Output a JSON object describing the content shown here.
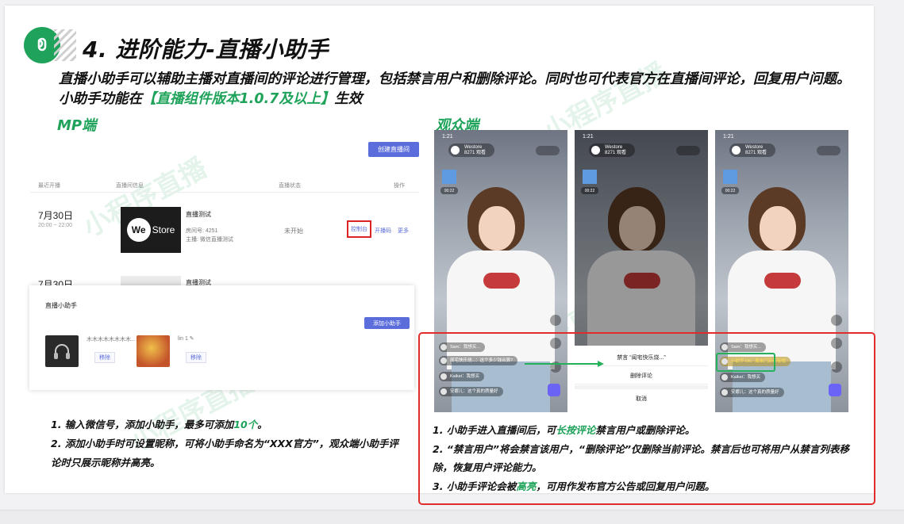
{
  "slide": {
    "title": "4. 进阶能力-直播小助手",
    "desc_part1": "直播小助手可以辅助主播对直播间的评论进行管理，包括禁言用户和删除评论。同时也可代表官方在直播间评论，回复用户问题。小助手功能在",
    "desc_highlight": "【直播组件版本1.0.7及以上】",
    "desc_part2": "生效",
    "mp_label": "MP端",
    "viewer_label": "观众端",
    "watermark": "小程序直播"
  },
  "mp": {
    "create_button": "创建直播间",
    "headers": [
      "最近开播",
      "直播间信息",
      "直播状态",
      "操作"
    ],
    "rows": [
      {
        "date": "7月30日",
        "time": "20:00 ~ 22:00",
        "thumb_text_a": "We",
        "thumb_text_b": "Store",
        "room_title": "直播测试",
        "room_no": "房间号:  4251",
        "host": "主播:    微信直播测试",
        "status": "未开始",
        "action_console": "控制台",
        "action_push": "开播码",
        "action_more": "更多"
      },
      {
        "date": "7月30日",
        "room_title": "直播测试"
      }
    ],
    "assistant": {
      "title": "直播小助手",
      "add_button": "添加小助手",
      "users": [
        {
          "name": "木木木木木木木木...",
          "remove": "移除"
        },
        {
          "name": "lin 1 ✎",
          "remove": "移除"
        }
      ]
    },
    "notes": {
      "line1_a": "1. 输入微信号，添加小助手，最多可添加",
      "line1_hl": "10个",
      "line1_b": "。",
      "line2": "2. 添加小助手时可设置昵称，可将小助手命名为“XXX官方”，观众端小助手评论时只展示昵称并高亮。"
    }
  },
  "viewer": {
    "phones": [
      {
        "time": "1:21",
        "anchor_name": "Westore",
        "anchor_sub": "8271 观看",
        "gift_timer": "00:22",
        "comments": [
          "Sam：我想买...",
          "闺宅快乐烧...：这个多少钱合算?",
          "Kaikei：我想买",
          "安娜儿：这个真的质量好"
        ]
      },
      {
        "time": "1:21",
        "anchor_name": "Westore",
        "anchor_sub": "8271 观看",
        "gift_timer": "00:22",
        "sheet_title": "禁言 “闺宅快乐烧...”",
        "sheet_delete": "删除评论",
        "sheet_cancel": "取消"
      },
      {
        "time": "1:21",
        "anchor_name": "Westore",
        "anchor_sub": "8271 观看",
        "gift_timer": "00:22",
        "comments": [
          "Sam：我想买...",
          "小助手 Oli：周末门店都有哦",
          "Kaikei：我想买",
          "安娜儿：这个真的质量好"
        ]
      }
    ],
    "notes": {
      "line1_a": "1. 小助手进入直播间后，可",
      "line1_hl": "长按评论",
      "line1_b": "禁言用户或删除评论。",
      "line2": "2. “禁言用户”将会禁言该用户，“删除评论”仅删除当前评论。禁言后也可将用户从禁言列表移除，恢复用户评论能力。",
      "line3_a": "3. 小助手评论会被",
      "line3_hl": "高亮",
      "line3_b": "，可用作发布官方公告或回复用户问题。"
    }
  },
  "colors": {
    "accent": "#1fa35a",
    "primary_button": "#5b6ddb",
    "highlight_box": "#e12c2c"
  }
}
